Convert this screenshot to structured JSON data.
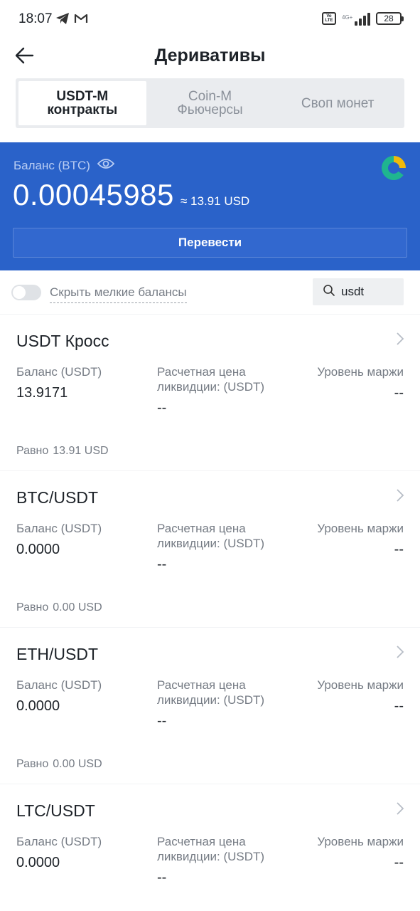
{
  "status": {
    "time": "18:07",
    "network": "4G+",
    "battery": "28"
  },
  "header": {
    "title": "Деривативы"
  },
  "tabs": [
    {
      "line1": "USDT-M",
      "line2": "контракты",
      "active": true
    },
    {
      "line1": "Coin-M",
      "line2": "Фьючерсы",
      "active": false
    },
    {
      "line1": "Своп монет",
      "line2": "",
      "active": false
    }
  ],
  "balance": {
    "label": "Баланс (BTC)",
    "value": "0.00045985",
    "usd": "≈ 13.91 USD",
    "transfer_label": "Перевести"
  },
  "filter": {
    "hide_small_label": "Скрыть мелкие балансы",
    "search_value": "usdt"
  },
  "labels": {
    "balance": "Баланс (USDT)",
    "liq_price": "Расчетная цена ликвидции: (USDT)",
    "margin_level": "Уровень маржи",
    "equal": "Равно"
  },
  "cards": [
    {
      "title": "USDT Кросс",
      "balance": "13.9171",
      "liq": "--",
      "margin": "--",
      "equal": "13.91 USD"
    },
    {
      "title": "BTC/USDT",
      "balance": "0.0000",
      "liq": "--",
      "margin": "--",
      "equal": "0.00 USD"
    },
    {
      "title": "ETH/USDT",
      "balance": "0.0000",
      "liq": "--",
      "margin": "--",
      "equal": "0.00 USD"
    },
    {
      "title": "LTC/USDT",
      "balance": "0.0000",
      "liq": "--",
      "margin": "--",
      "equal": ""
    }
  ],
  "colors": {
    "accent": "#2a62c9",
    "text": "#1e2329",
    "muted": "#757b84"
  }
}
